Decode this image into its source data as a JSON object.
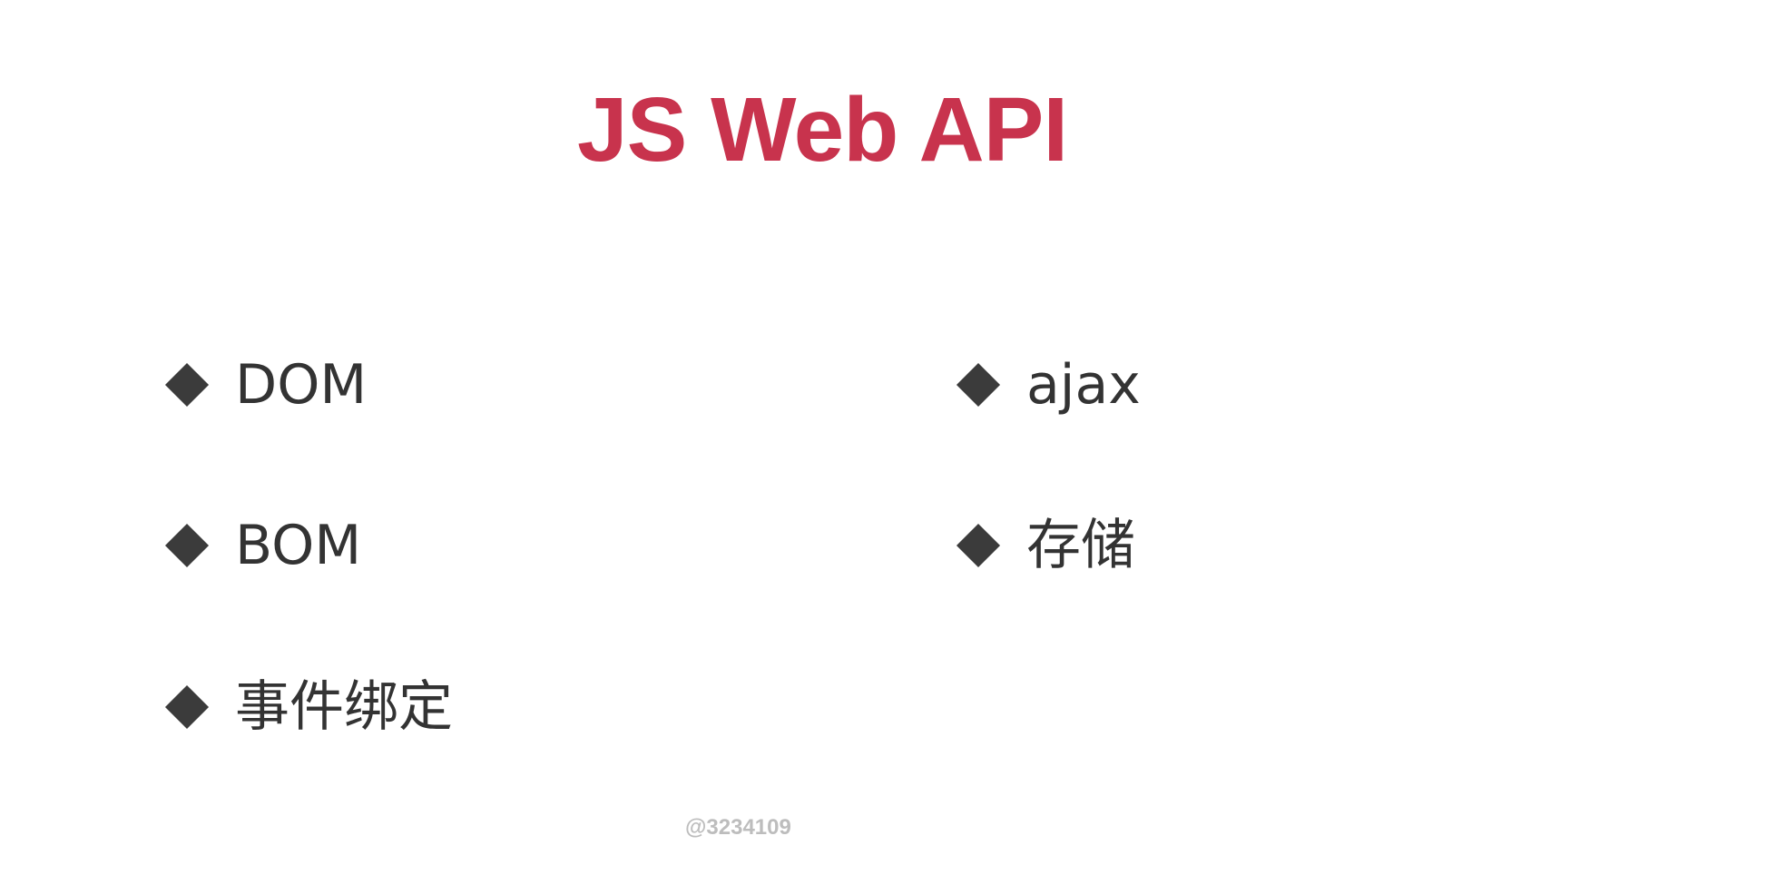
{
  "slide": {
    "title": "JS Web API",
    "title_color": "#c8334d",
    "bullet_icon": "diamond-bullet-icon",
    "bullet_color": "#3b3b3b",
    "left_column": [
      {
        "label": "DOM"
      },
      {
        "label": "BOM"
      },
      {
        "label": "事件绑定"
      }
    ],
    "right_column": [
      {
        "label": "ajax"
      },
      {
        "label": "存储"
      }
    ],
    "watermark": "@3234109"
  }
}
